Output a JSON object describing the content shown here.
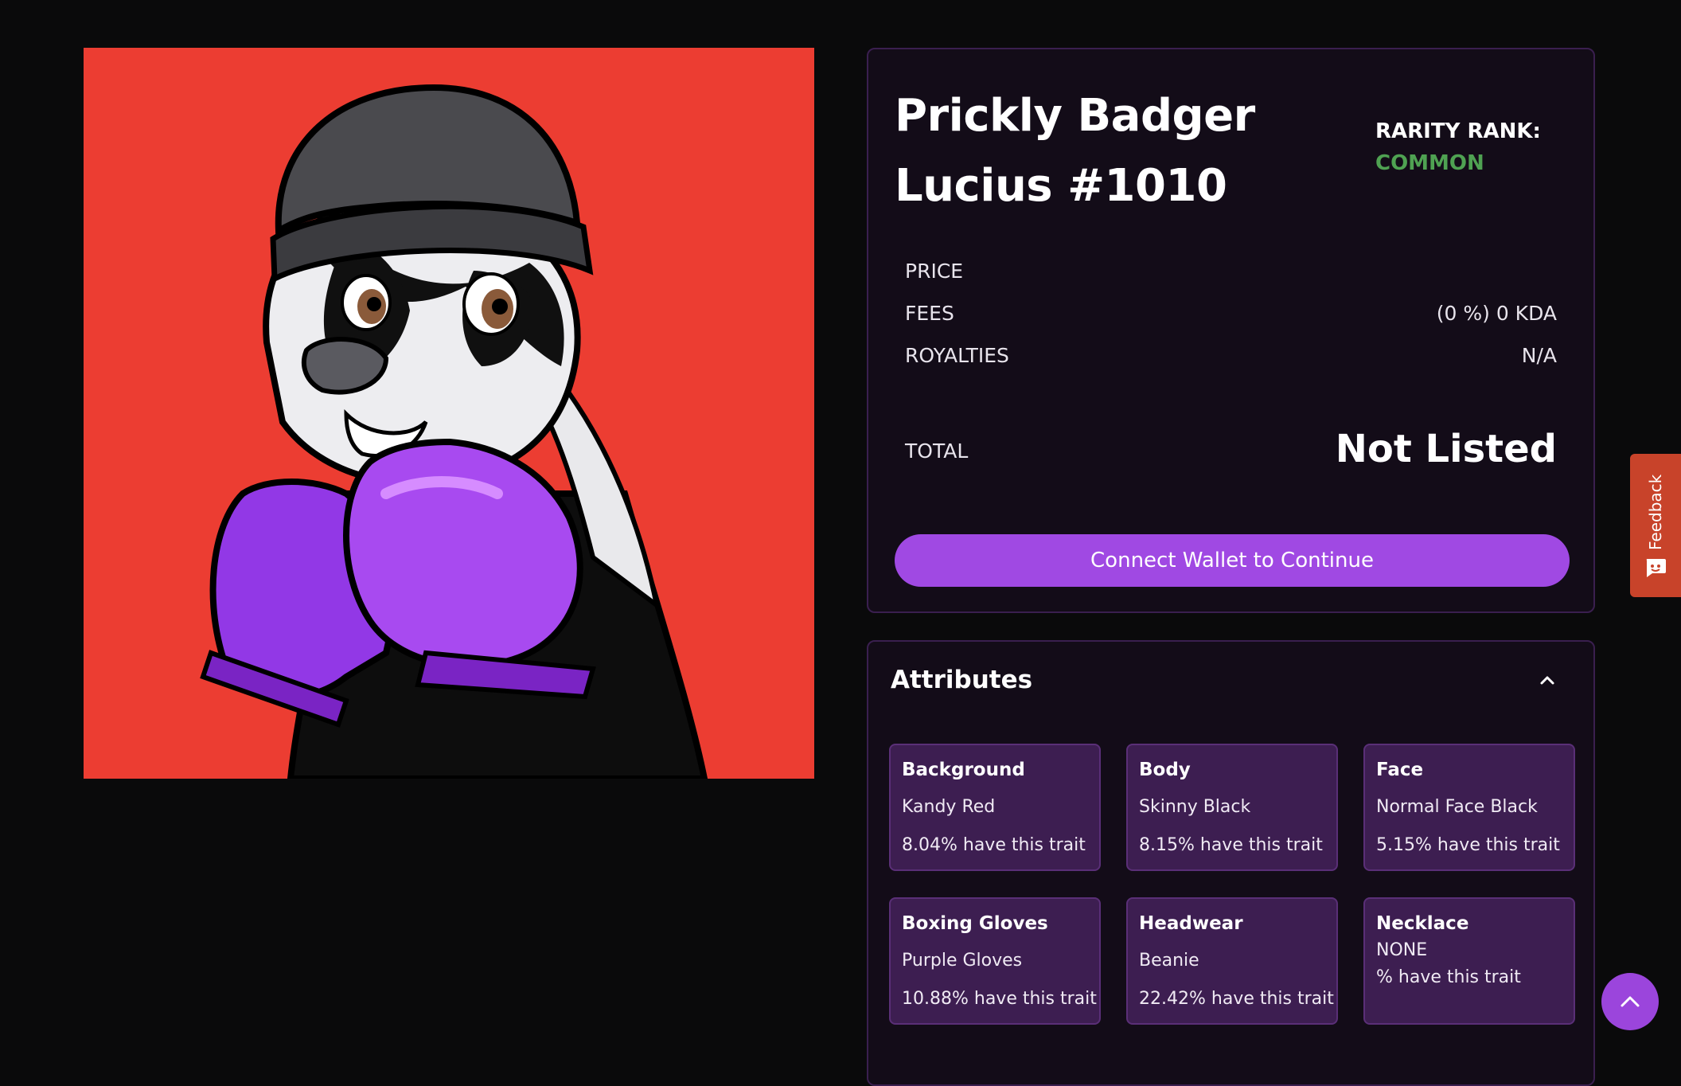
{
  "nft": {
    "image_alt": "Prickly Badger Lucius #1010 artwork",
    "title": "Prickly Badger Lucius #1010",
    "rarity_label": "RARITY RANK:",
    "rarity_value": "COMMON"
  },
  "listing": {
    "price_label": "PRICE",
    "fees_label": "FEES",
    "fees_value": "(0 %) 0 KDA",
    "royalties_label": "ROYALTIES",
    "royalties_value": "N/A",
    "total_label": "TOTAL",
    "total_value": "Not Listed",
    "connect_label": "Connect Wallet to Continue"
  },
  "attributes": {
    "title": "Attributes",
    "traits": [
      {
        "type": "Background",
        "value": "Kandy Red",
        "pct": "8.04% have this trait"
      },
      {
        "type": "Body",
        "value": "Skinny Black",
        "pct": "8.15% have this trait"
      },
      {
        "type": "Face",
        "value": "Normal Face Black",
        "pct": "5.15% have this trait"
      },
      {
        "type": "Boxing Gloves",
        "value": "Purple Gloves",
        "pct": "10.88% have this trait"
      },
      {
        "type": "Headwear",
        "value": "Beanie",
        "pct": "22.42% have this trait"
      },
      {
        "type": "Necklace",
        "value": "NONE",
        "pct": "% have this trait"
      }
    ]
  },
  "feedback": {
    "label": "Feedback"
  },
  "colors": {
    "background": "#0a0a0b",
    "card": "#130c18",
    "accent": "#a049e3",
    "rarity_common": "#4fa252",
    "art_background": "#ec3d32",
    "trait_card": "#3d1e51",
    "feedback": "#c8432a"
  },
  "icons": {
    "collapse": "chevron-up-icon",
    "feedback": "chat-icon",
    "scroll_top": "chevron-up-icon"
  }
}
